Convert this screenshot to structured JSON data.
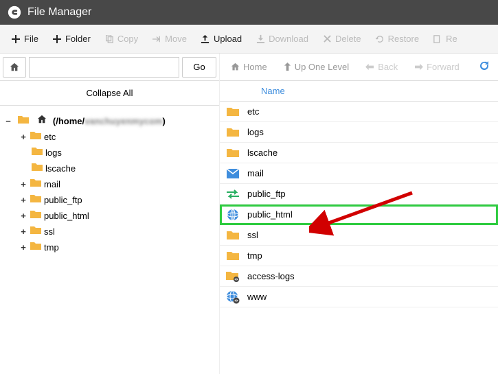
{
  "header": {
    "title": "File Manager"
  },
  "toolbar": {
    "file": "File",
    "folder": "Folder",
    "copy": "Copy",
    "move": "Move",
    "upload": "Upload",
    "download": "Download",
    "delete": "Delete",
    "restore": "Restore",
    "rename": "Re"
  },
  "pathbar": {
    "value": "",
    "go": "Go"
  },
  "tree": {
    "collapse_all": "Collapse All",
    "root_prefix": "(/home/",
    "root_user": "vanchuyenmycom",
    "root_suffix": ")",
    "items": [
      {
        "label": "etc",
        "expandable": true
      },
      {
        "label": "logs",
        "expandable": false
      },
      {
        "label": "lscache",
        "expandable": false
      },
      {
        "label": "mail",
        "expandable": true
      },
      {
        "label": "public_ftp",
        "expandable": true
      },
      {
        "label": "public_html",
        "expandable": true
      },
      {
        "label": "ssl",
        "expandable": true
      },
      {
        "label": "tmp",
        "expandable": true
      }
    ]
  },
  "nav": {
    "home": "Home",
    "up": "Up One Level",
    "back": "Back",
    "forward": "Forward"
  },
  "columns": {
    "name": "Name"
  },
  "rows": [
    {
      "name": "etc",
      "icon": "folder",
      "highlighted": false
    },
    {
      "name": "logs",
      "icon": "folder",
      "highlighted": false
    },
    {
      "name": "lscache",
      "icon": "folder",
      "highlighted": false
    },
    {
      "name": "mail",
      "icon": "mail",
      "highlighted": false
    },
    {
      "name": "public_ftp",
      "icon": "ftp",
      "highlighted": false
    },
    {
      "name": "public_html",
      "icon": "globe",
      "highlighted": true
    },
    {
      "name": "ssl",
      "icon": "folder",
      "highlighted": false
    },
    {
      "name": "tmp",
      "icon": "folder",
      "highlighted": false
    },
    {
      "name": "access-logs",
      "icon": "folder-link",
      "highlighted": false
    },
    {
      "name": "www",
      "icon": "globe-link",
      "highlighted": false
    }
  ]
}
